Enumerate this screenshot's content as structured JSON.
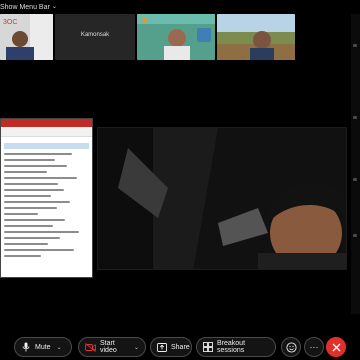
{
  "menu_bar": {
    "label": "Show Menu Bar"
  },
  "participants": [
    {
      "name": ""
    },
    {
      "name": "Kamonsak"
    },
    {
      "name": ""
    },
    {
      "name": ""
    }
  ],
  "toolbar": {
    "mute_label": "Mute",
    "video_label": "Start video",
    "share_label": "Share",
    "breakout_label": "Breakout sessions",
    "more_label": "···"
  }
}
